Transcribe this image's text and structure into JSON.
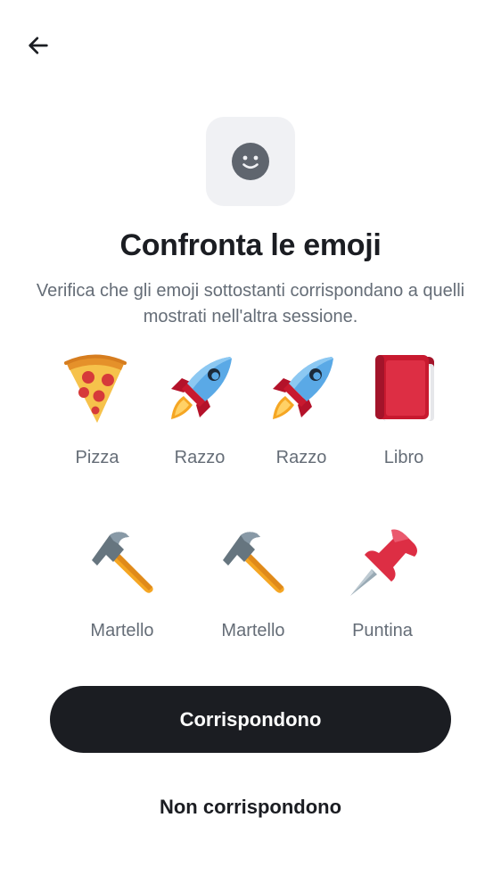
{
  "nav": {
    "back_icon": "arrow-left-icon"
  },
  "header": {
    "icon": "smiley-face-icon",
    "title": "Confronta le emoji"
  },
  "description": "Verifica che gli emoji sottostanti corrispondano a quelli mostrati nell'altra sessione.",
  "emojis_row1": [
    {
      "label": "Pizza",
      "icon": "pizza-icon"
    },
    {
      "label": "Razzo",
      "icon": "rocket-icon"
    },
    {
      "label": "Razzo",
      "icon": "rocket-icon"
    },
    {
      "label": "Libro",
      "icon": "book-icon"
    }
  ],
  "emojis_row2": [
    {
      "label": "Martello",
      "icon": "hammer-icon"
    },
    {
      "label": "Martello",
      "icon": "hammer-icon"
    },
    {
      "label": "Puntina",
      "icon": "pushpin-icon"
    }
  ],
  "actions": {
    "confirm_label": "Corrispondono",
    "reject_label": "Non corrispondono"
  },
  "colors": {
    "primary": "#1b1d22",
    "secondary_text": "#656d77",
    "icon_bg": "#f0f1f4"
  }
}
